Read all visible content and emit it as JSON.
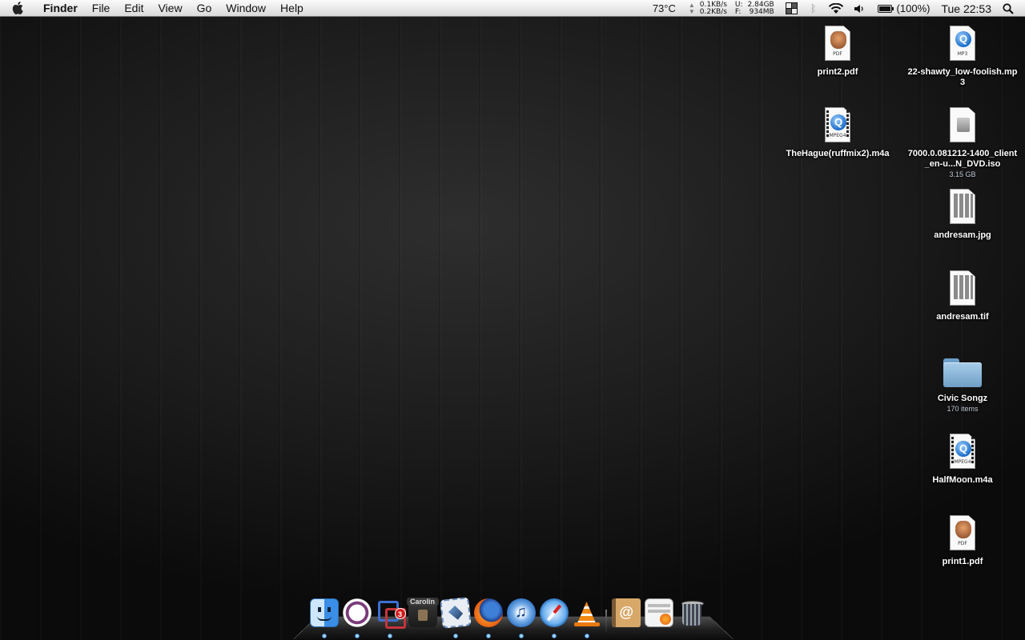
{
  "menubar": {
    "app_name": "Finder",
    "menus": [
      "File",
      "Edit",
      "View",
      "Go",
      "Window",
      "Help"
    ],
    "status": {
      "temperature": "73°C",
      "net_down": "0.1KB/s",
      "net_up": "0.2KB/s",
      "disk_used_label": "U:",
      "disk_used": "2.84GB",
      "disk_free_label": "F:",
      "disk_free": "934MB",
      "battery": "(100%)",
      "clock": "Tue 22:53"
    }
  },
  "desktop": {
    "icons": [
      {
        "label": "print2.pdf",
        "sub": "",
        "kind": "pdf",
        "tag": "PDF"
      },
      {
        "label": "22-shawty_low-foolish.mp3",
        "sub": "",
        "kind": "mp3",
        "tag": "MP3"
      },
      {
        "label": "TheHague(ruffmix2).m4a",
        "sub": "",
        "kind": "mpeg4",
        "tag": "MPEG4"
      },
      {
        "label": "7000.0.081212-1400_client_en-u...N_DVD.iso",
        "sub": "3.15 GB",
        "kind": "iso",
        "tag": ""
      },
      {
        "label": "andresam.jpg",
        "sub": "",
        "kind": "image",
        "tag": ""
      },
      {
        "label": "andresam.tif",
        "sub": "",
        "kind": "image",
        "tag": ""
      },
      {
        "label": "Civic Songz",
        "sub": "170 items",
        "kind": "folder",
        "tag": ""
      },
      {
        "label": "HalfMoon.m4a",
        "sub": "",
        "kind": "mpeg4",
        "tag": "MPEG4"
      },
      {
        "label": "print1.pdf",
        "sub": "",
        "kind": "pdf",
        "tag": "PDF"
      }
    ]
  },
  "dock": {
    "items": [
      {
        "icon": "finder-icon",
        "running": true
      },
      {
        "icon": "adium-icon",
        "running": true
      },
      {
        "icon": "virtual-machine-icon",
        "running": true,
        "badge": "3"
      },
      {
        "icon": "caroline-widget-icon",
        "running": false,
        "label": "Carolin"
      },
      {
        "icon": "mail-icon",
        "running": true
      },
      {
        "icon": "firefox-icon",
        "running": true
      },
      {
        "icon": "itunes-icon",
        "running": true
      },
      {
        "icon": "safari-icon",
        "running": true
      },
      {
        "icon": "vlc-icon",
        "running": true
      },
      {
        "icon": "address-book-icon",
        "running": false
      },
      {
        "icon": "documents-stack-icon",
        "running": false
      },
      {
        "icon": "trash-icon",
        "running": false
      }
    ]
  },
  "colors": {
    "desktop_bg": "#1c1c1c",
    "menubar_bg": "#e9e9e9",
    "label_text": "#ffffff",
    "accent_blue": "#4aa3ff"
  }
}
